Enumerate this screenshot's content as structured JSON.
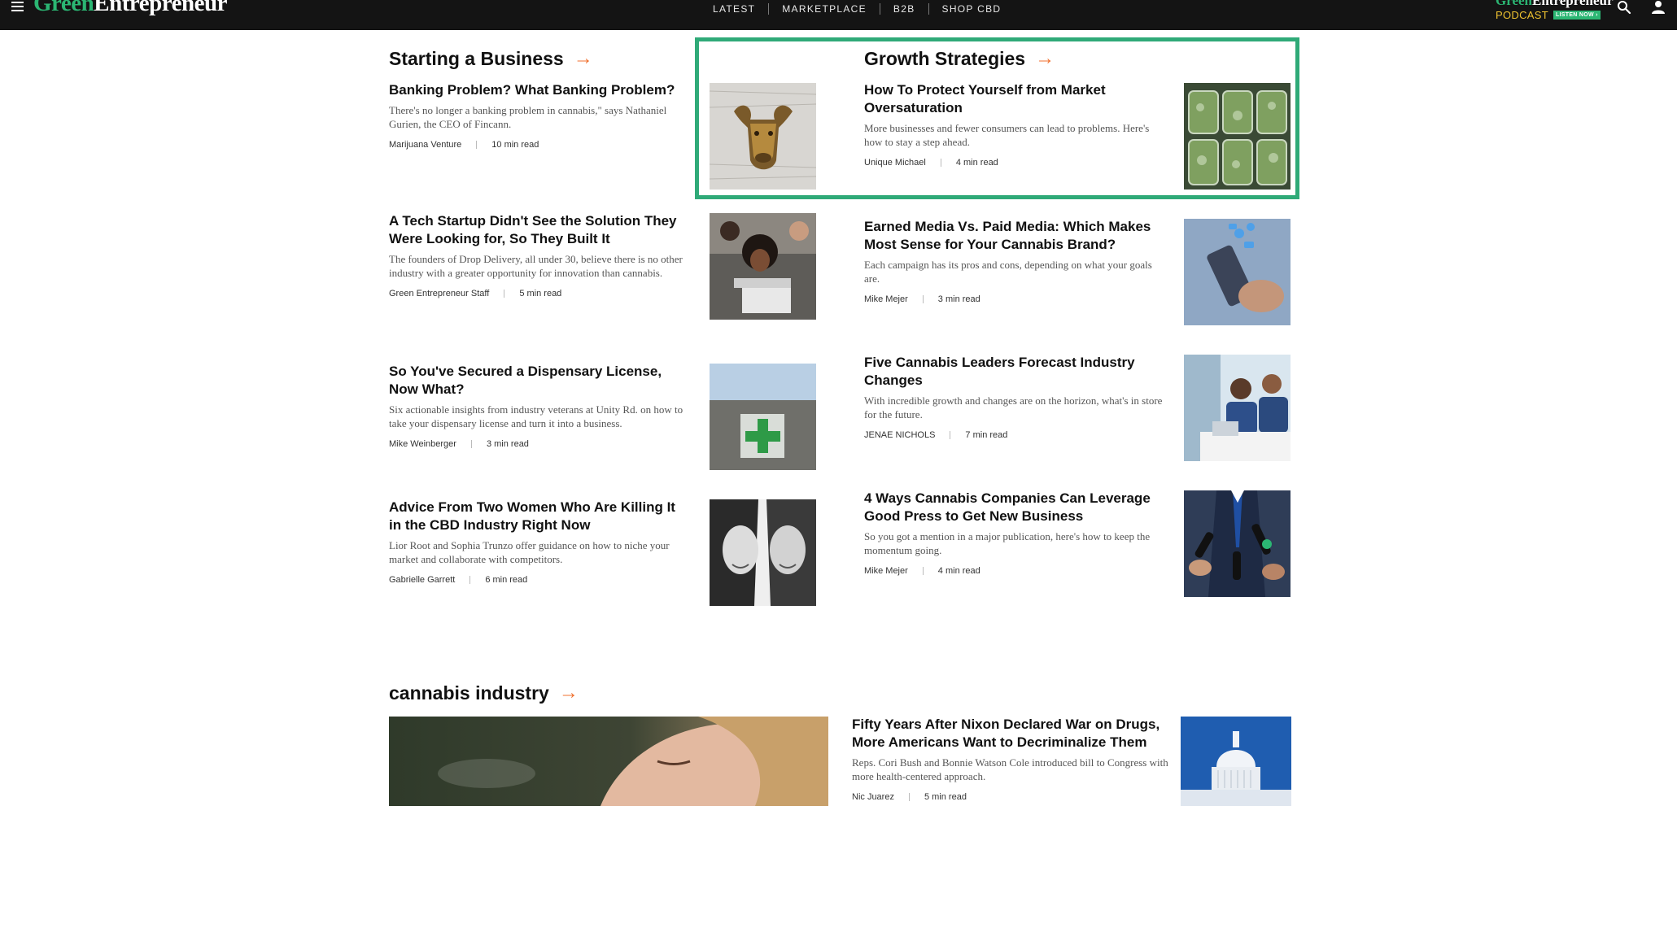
{
  "header": {
    "logo_green": "Green",
    "logo_white": "Entrepreneur",
    "nav": [
      "LATEST",
      "MARKETPLACE",
      "B2B",
      "SHOP CBD"
    ],
    "podcast_logo_green": "Green",
    "podcast_logo_white": "Entrepreneur",
    "podcast_label": "PODCAST",
    "podcast_cta": "LISTEN NOW ›",
    "icons": [
      "menu-icon",
      "search-icon",
      "user-icon"
    ]
  },
  "starting_business": {
    "title": "Starting a Business",
    "articles": [
      {
        "title": "Banking Problem? What Banking Problem?",
        "desc": "There's no longer a banking problem in cannabis,\" says Nathaniel Gurien, the CEO of Fincann.",
        "author": "Marijuana Venture",
        "read": "10 min read"
      },
      {
        "title": "A Tech Startup Didn't See the Solution They Were Looking for, So They Built It",
        "desc": "The founders of Drop Delivery, all under 30, believe there is no other industry with a greater opportunity for innovation than cannabis.",
        "author": "Green Entrepreneur Staff",
        "read": "5 min read"
      },
      {
        "title": "So You've Secured a Dispensary License, Now What?",
        "desc": "Six actionable insights from industry veterans at Unity Rd. on how to take your dispensary license and turn it into a business.",
        "author": "Mike Weinberger",
        "read": "3 min read"
      },
      {
        "title": "Advice From Two Women Who Are Killing It in the CBD Industry Right Now",
        "desc": "Lior Root and Sophia Trunzo offer guidance on how to niche your market and collaborate with competitors.",
        "author": "Gabrielle Garrett",
        "read": "6 min read"
      }
    ]
  },
  "growth_strategies": {
    "title": "Growth Strategies",
    "articles": [
      {
        "title": "How To Protect Yourself from Market Oversaturation",
        "desc": "More businesses and fewer consumers can lead to problems. Here's how to stay a step ahead.",
        "author": "Unique Michael",
        "read": "4 min read"
      },
      {
        "title": "Earned Media Vs. Paid Media: Which Makes Most Sense for Your Cannabis Brand?",
        "desc": "Each campaign has its pros and cons, depending on what your goals are.",
        "author": "Mike Mejer",
        "read": "3 min read"
      },
      {
        "title": "Five Cannabis Leaders Forecast Industry Changes",
        "desc": "With incredible growth and changes are on the horizon, what's in store for the future.",
        "author": "JENAE NICHOLS",
        "read": "7 min read"
      },
      {
        "title": "4 Ways Cannabis Companies Can Leverage Good Press to Get New Business",
        "desc": "So you got a mention in a major publication, here's how to keep the momentum going.",
        "author": "Mike Mejer",
        "read": "4 min read"
      }
    ]
  },
  "cannabis_industry": {
    "title": "cannabis industry",
    "articles": [
      {
        "title": "Fifty Years After Nixon Declared War on Drugs, More Americans Want to Decriminalize Them",
        "desc": "Reps. Cori Bush and Bonnie Watson Cole introduced bill to Congress with more health-centered approach.",
        "author": "Nic Juarez",
        "read": "5 min read"
      }
    ]
  },
  "colors": {
    "accent_arrow": "#f0712f",
    "brand_green": "#2bb673",
    "highlight_border": "#2faa78",
    "topbar": "#141414"
  }
}
